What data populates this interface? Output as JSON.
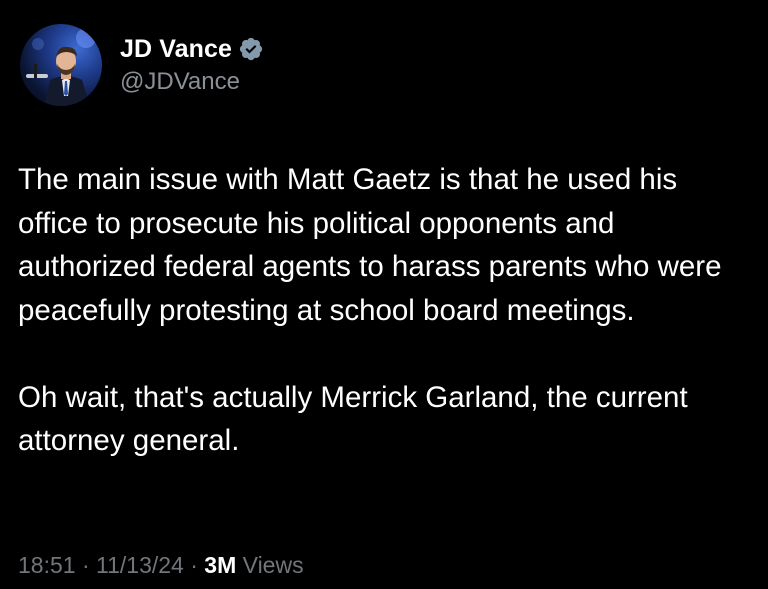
{
  "author": {
    "display_name": "JD Vance",
    "handle": "@JDVance",
    "verified": true
  },
  "tweet": {
    "paragraph1": "The main issue with Matt Gaetz is that he used his office to prosecute his political opponents and authorized federal agents to harass parents who were peacefully protesting at school board meetings.",
    "paragraph2": "Oh wait, that's actually Merrick Garland, the current attorney general."
  },
  "meta": {
    "time": "18:51",
    "separator1": " · ",
    "date": "11/13/24",
    "separator2": " · ",
    "views_count": "3M",
    "views_label": " Views"
  },
  "colors": {
    "background": "#000000",
    "text_primary": "#ffffff",
    "text_secondary": "#71767b",
    "verified_badge": "#829aab"
  },
  "icons": {
    "verified": "verified-badge-icon"
  }
}
